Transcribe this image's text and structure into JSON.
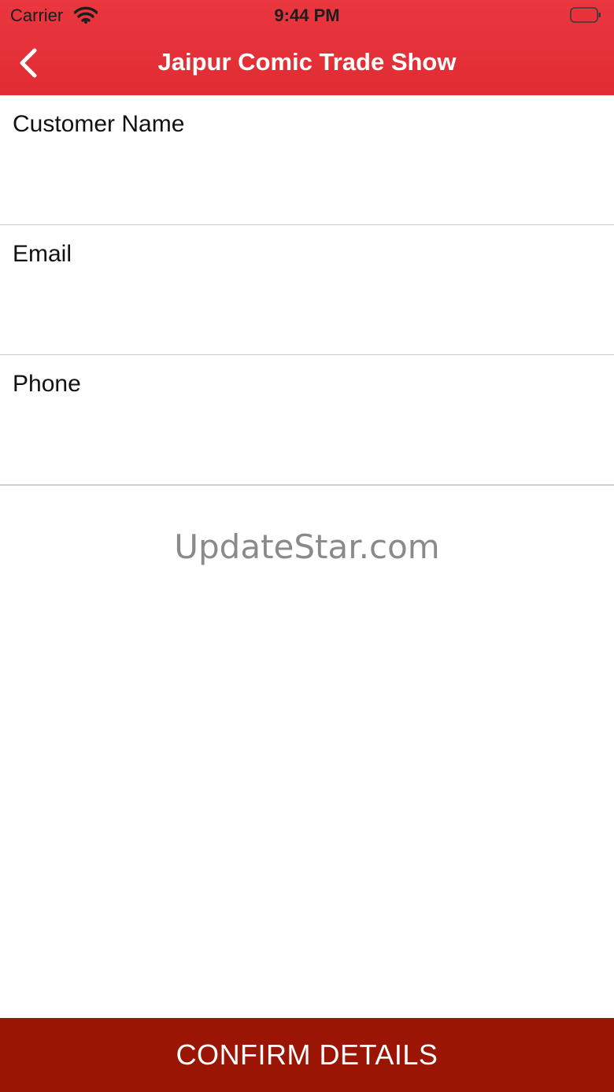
{
  "status_bar": {
    "carrier": "Carrier",
    "time": "9:44 PM",
    "wifi_icon": "wifi-icon",
    "battery_icon": "battery-low-icon"
  },
  "nav": {
    "back_icon": "chevron-left-icon",
    "title": "Jaipur Comic Trade Show"
  },
  "form": {
    "customer_name_label": "Customer Name",
    "email_label": "Email",
    "phone_label": "Phone"
  },
  "watermark": "UpdateStar.com",
  "confirm_button_label": "CONFIRM DETAILS",
  "colors": {
    "header_red": "#e3303a",
    "button_dark_red": "#9b1505",
    "battery_red": "#e8323a",
    "divider": "#cfcfcf"
  }
}
